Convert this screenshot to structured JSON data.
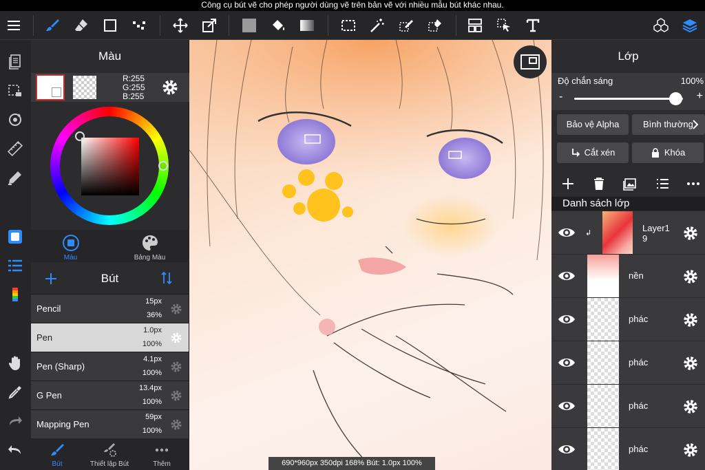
{
  "caption": "Công cụ bút vẽ cho phép người dùng vẽ trên bản vẽ với nhiều mẫu bút khác nhau.",
  "color_panel": {
    "title": "Màu",
    "rgb": {
      "r": "R:255",
      "g": "G:255",
      "b": "B:255"
    },
    "tabs": [
      {
        "label": "Màu",
        "icon": "color-circle-icon"
      },
      {
        "label": "Bảng Màu",
        "icon": "palette-icon"
      }
    ]
  },
  "brush_panel": {
    "title": "Bút",
    "brushes": [
      {
        "name": "Pencil",
        "size": "15px",
        "opacity": "36%"
      },
      {
        "name": "Pen",
        "size": "1.0px",
        "opacity": "100%"
      },
      {
        "name": "Pen (Sharp)",
        "size": "4.1px",
        "opacity": "100%"
      },
      {
        "name": "G Pen",
        "size": "13.4px",
        "opacity": "100%"
      },
      {
        "name": "Mapping Pen",
        "size": "59px",
        "opacity": "100%"
      }
    ],
    "selected_index": 1,
    "tabs": [
      {
        "label": "Bút",
        "icon": "brush-icon"
      },
      {
        "label": "Thiết lập Bút",
        "icon": "brush-settings-icon"
      },
      {
        "label": "Thêm",
        "icon": "more-icon"
      }
    ]
  },
  "canvas": {
    "status": "690*960px 350dpi 168% Bút: 1.0px 100%"
  },
  "layer_panel": {
    "title": "Lớp",
    "opacity_label": "Độ chắn sáng",
    "opacity_value": "100%",
    "opacity_fraction": 0.93,
    "minus": "-",
    "plus": "+",
    "alpha_protect": "Bảo vệ Alpha",
    "blend_mode": "Bình thường",
    "clipping": "Cắt xén",
    "lock": "Khóa",
    "list_title": "Danh sách lớp",
    "layers": [
      {
        "name": "Layer1\n9",
        "clipped": true
      },
      {
        "name": "nền",
        "clipped": false
      },
      {
        "name": "phác",
        "clipped": false
      },
      {
        "name": "phác",
        "clipped": false
      },
      {
        "name": "phác",
        "clipped": false
      },
      {
        "name": "phác",
        "clipped": false
      }
    ]
  },
  "colors": {
    "accent": "#2f8cff",
    "selected_swatch_border": "#c0312f"
  }
}
